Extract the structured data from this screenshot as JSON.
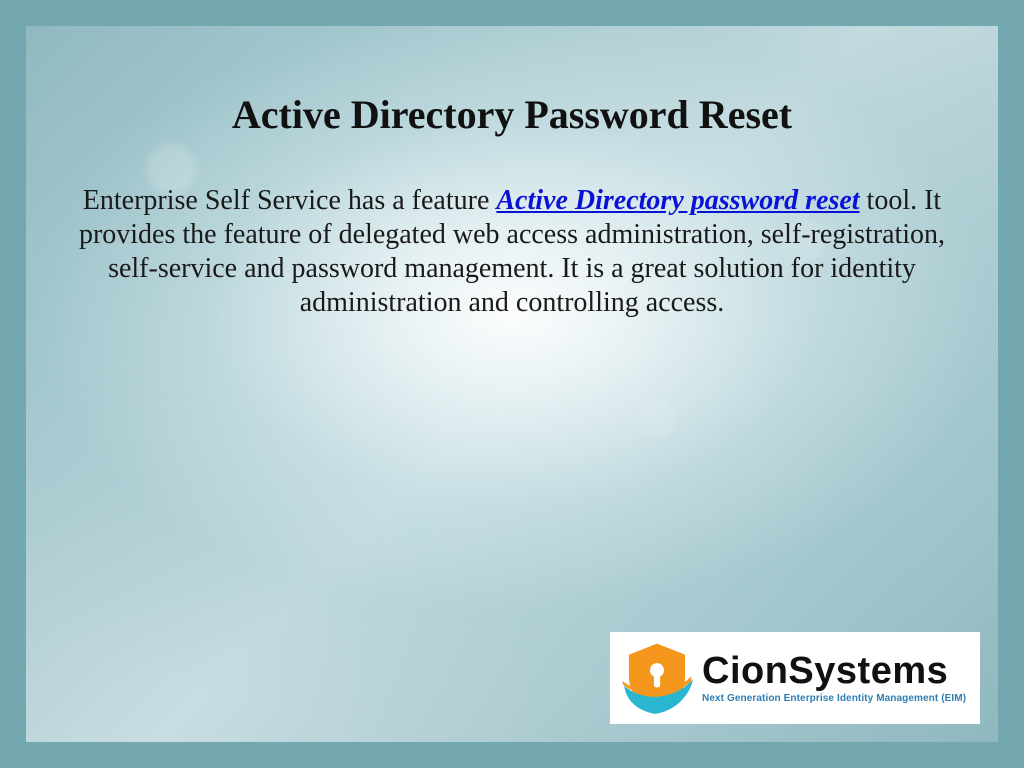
{
  "title": "Active Directory Password Reset",
  "body": {
    "pre": "Enterprise Self Service has a feature ",
    "link": "Active Directory password reset",
    "post": " tool. It provides the feature of delegated web access administration, self-registration, self-service and password management. It is a great solution for identity administration and controlling access."
  },
  "logo": {
    "brand": "CionSystems",
    "tagline": "Next Generation Enterprise Identity Management (EIM)",
    "icon": "shield-lock-icon"
  }
}
